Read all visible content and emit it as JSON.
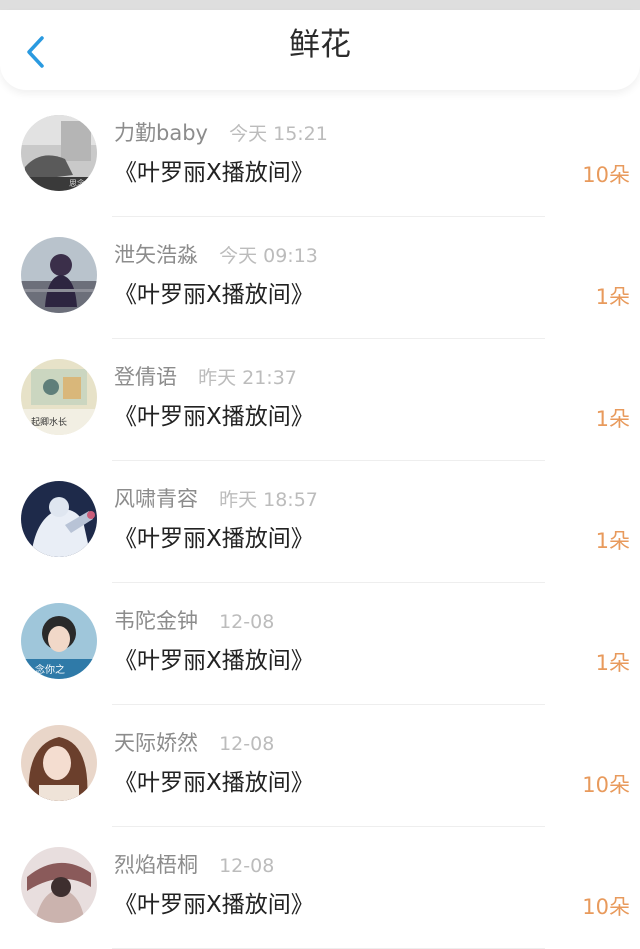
{
  "header": {
    "title": "鲜花",
    "back_icon": "chevron-left-icon",
    "back_color": "#2a9ae0"
  },
  "accent": {
    "count_color": "#e89a5c"
  },
  "items": [
    {
      "username": "力勤baby",
      "time": "今天 15:21",
      "room": "《叶罗丽X播放间》",
      "count": "10朵",
      "avatar_caption": "思念"
    },
    {
      "username": "泄矢浩淼",
      "time": "今天 09:13",
      "room": "《叶罗丽X播放间》",
      "count": "1朵"
    },
    {
      "username": "登倩语",
      "time": "昨天 21:37",
      "room": "《叶罗丽X播放间》",
      "count": "1朵",
      "avatar_caption": "起卿水长"
    },
    {
      "username": "风啸青容",
      "time": "昨天 18:57",
      "room": "《叶罗丽X播放间》",
      "count": "1朵"
    },
    {
      "username": "韦陀金钟",
      "time": "12-08",
      "room": "《叶罗丽X播放间》",
      "count": "1朵",
      "avatar_caption": "念你之"
    },
    {
      "username": "天际娇然",
      "time": "12-08",
      "room": "《叶罗丽X播放间》",
      "count": "10朵"
    },
    {
      "username": "烈焰梧桐",
      "time": "12-08",
      "room": "《叶罗丽X播放间》",
      "count": "10朵"
    }
  ]
}
